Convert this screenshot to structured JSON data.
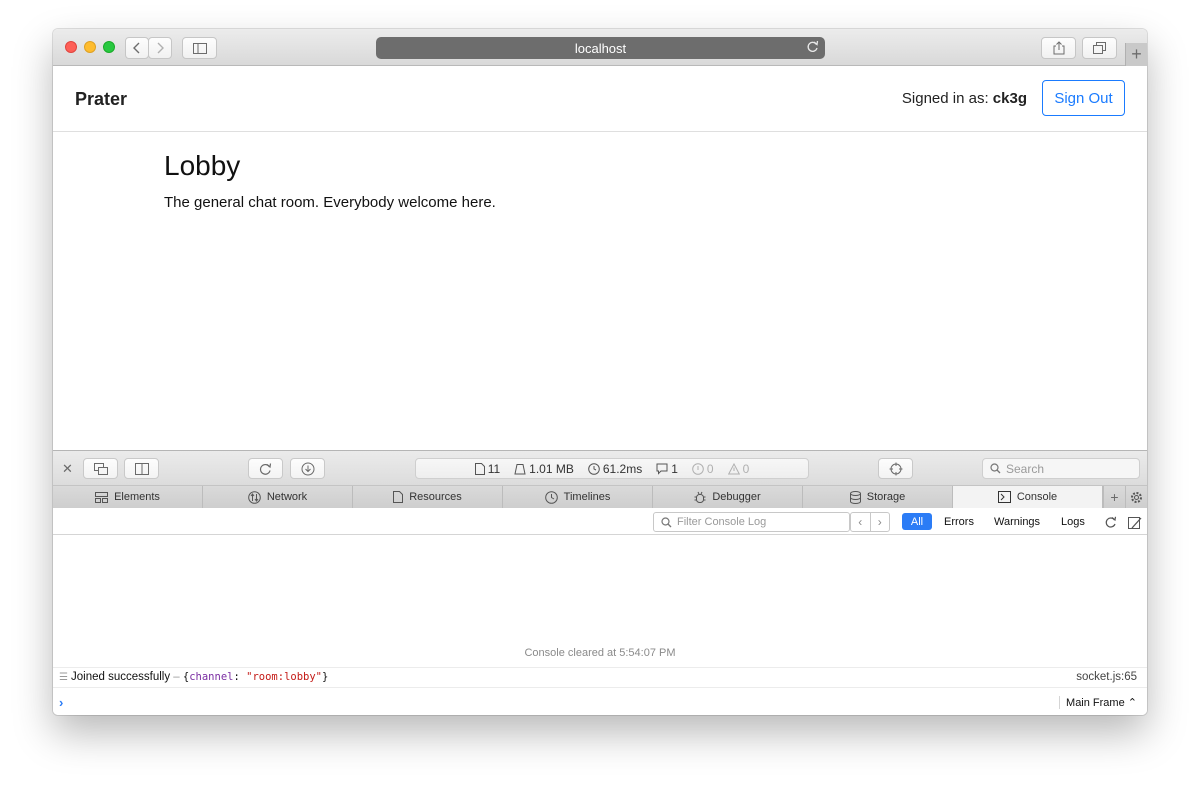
{
  "browser": {
    "url": "localhost"
  },
  "page": {
    "brand": "Prater",
    "signed_in_prefix": "Signed in as:",
    "username": "ck3g",
    "sign_out_label": "Sign Out",
    "room_title": "Lobby",
    "room_description": "The general chat room. Everybody welcome here."
  },
  "inspector": {
    "activity": {
      "resources": "11",
      "size": "1.01 MB",
      "load_time": "61.2ms",
      "logs": "1",
      "errors": "0",
      "warnings": "0"
    },
    "search_placeholder": "Search",
    "tabs": [
      {
        "label": "Elements",
        "icon": "elements-icon"
      },
      {
        "label": "Network",
        "icon": "network-icon"
      },
      {
        "label": "Resources",
        "icon": "resources-icon"
      },
      {
        "label": "Timelines",
        "icon": "timelines-icon"
      },
      {
        "label": "Debugger",
        "icon": "debugger-icon"
      },
      {
        "label": "Storage",
        "icon": "storage-icon"
      },
      {
        "label": "Console",
        "icon": "console-icon",
        "active": true
      }
    ],
    "console": {
      "filter_placeholder": "Filter Console Log",
      "scopes": [
        "All",
        "Errors",
        "Warnings",
        "Logs"
      ],
      "selected_scope": "All",
      "cleared_message": "Console cleared at 5:54:07 PM",
      "log": {
        "message": "Joined successfully",
        "separator": "–",
        "object_open": "{",
        "key": "channel",
        "colon": ":",
        "value": "\"room:lobby\"",
        "object_close": "}",
        "source": "socket.js:65"
      },
      "frame": "Main Frame"
    }
  },
  "colors": {
    "accent": "#1a7bff",
    "scope_selected": "#2b7cf6"
  }
}
